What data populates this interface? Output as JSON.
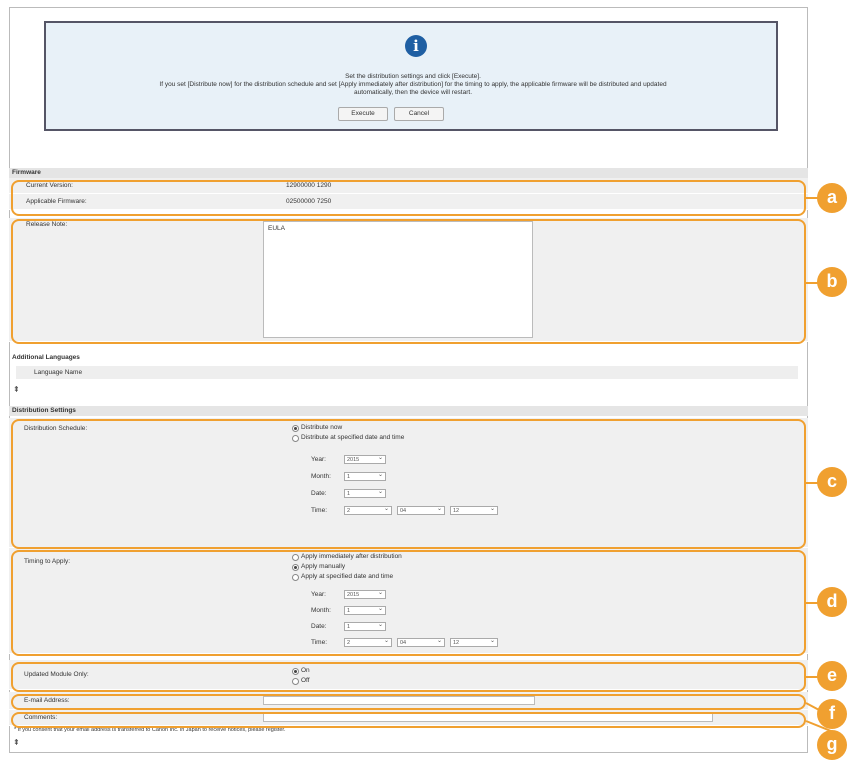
{
  "info": {
    "line1": "Set the distribution settings and click [Execute].",
    "line2": "If you set [Distribute now] for the distribution schedule and set [Apply immediately after distribution] for the timing to apply, the applicable firmware will be distributed and updated",
    "line3": "automatically, then the device will restart.",
    "execute": "Execute",
    "cancel": "Cancel"
  },
  "firmware": {
    "heading": "Firmware",
    "current_label": "Current Version:",
    "current_value": "12900000 1290",
    "applicable_label": "Applicable Firmware:",
    "applicable_value": "02500000 7250",
    "release_label": "Release Note:",
    "release_value": "EULA"
  },
  "languages": {
    "heading": "Additional Languages",
    "col": "Language Name"
  },
  "dist": {
    "heading": "Distribution Settings",
    "schedule_label": "Distribution Schedule:",
    "opt_now": "Distribute now",
    "opt_specified": "Distribute at specified date and time",
    "year": "Year:",
    "month": "Month:",
    "date": "Date:",
    "time": "Time:",
    "year_val": "2015",
    "month_val": "1",
    "date_val": "1",
    "h_val": "2",
    "m_val": "04",
    "s_val": "12",
    "timing_label": "Timing to Apply:",
    "opt_immediate": "Apply immediately after distribution",
    "opt_manual": "Apply manually",
    "opt_apply_specified": "Apply at specified date and time",
    "module_label": "Updated Module Only:",
    "on": "On",
    "off": "Off",
    "email_label": "E-mail Address:",
    "comments_label": "Comments:",
    "footnote": "* If you consent that your email address is transferred to Canon Inc. in Japan to receive notices, please register."
  },
  "callouts": [
    "a",
    "b",
    "c",
    "d",
    "e",
    "f",
    "g"
  ]
}
